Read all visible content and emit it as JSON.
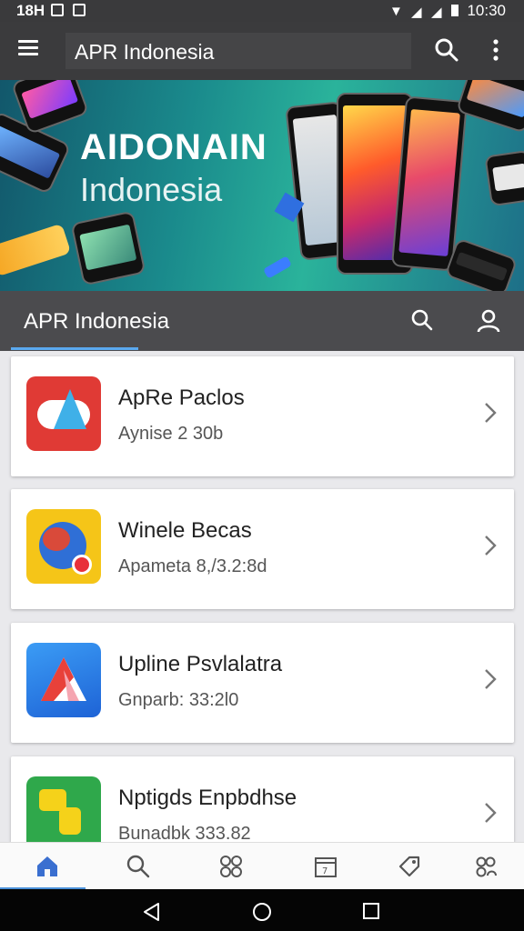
{
  "status_bar": {
    "time_left": "18H",
    "time_right": "10:30"
  },
  "app_bar": {
    "title": "APR Indonesia",
    "menu_icon": "hamburger-icon",
    "search_icon": "search-icon",
    "more_icon": "more-vert-icon"
  },
  "banner": {
    "headline": "AIDONAIN",
    "subline": "Indonesia"
  },
  "tab_header": {
    "title": "APR Indonesia"
  },
  "apps": [
    {
      "name": "ApRe Paclos",
      "meta": "Aynise 2 30b",
      "icon_color": "#e03a35",
      "icon": "red-shape-icon"
    },
    {
      "name": "Winele Becas",
      "meta": "Apameta 8,/3.2:8d",
      "icon_color": "#f5c518",
      "icon": "globe-icon"
    },
    {
      "name": "Upline Psvlalatra",
      "meta": "Gnparb: 33:2l0",
      "icon_color": "#2f86e8",
      "icon": "triangle-logo-icon"
    },
    {
      "name": "Nptigds Enpbdhse",
      "meta": "Bunadbk 333.82",
      "icon_color": "#2fa84b",
      "icon": "hand-pointer-icon"
    }
  ],
  "bottom_nav": {
    "items": [
      "home-icon",
      "search-icon",
      "grid-icon",
      "calendar-icon",
      "tag-icon",
      "people-icon"
    ],
    "active_color": "#4a90d9"
  },
  "system_nav": {
    "items": [
      "back-icon",
      "home-circle-icon",
      "recents-icon"
    ]
  }
}
